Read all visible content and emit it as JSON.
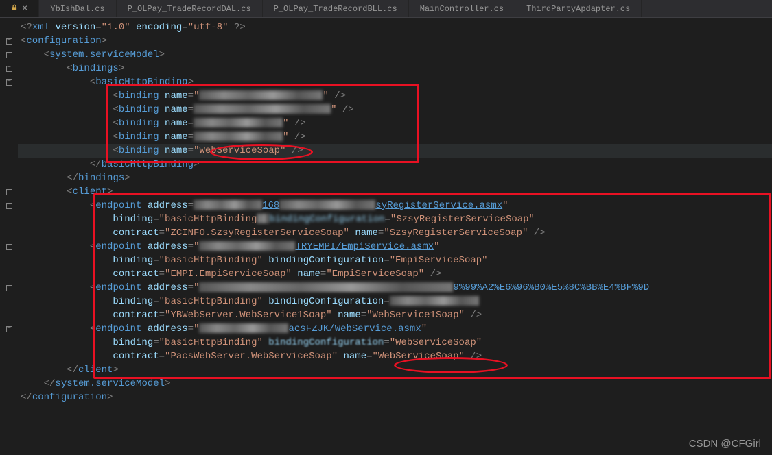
{
  "tabs": [
    {
      "label": "",
      "active": true,
      "hasLock": true,
      "hasClose": true
    },
    {
      "label": "YbIshDal.cs",
      "active": false
    },
    {
      "label": "P_OLPay_TradeRecordDAL.cs",
      "active": false
    },
    {
      "label": "P_OLPay_TradeRecordBLL.cs",
      "active": false
    },
    {
      "label": "MainController.cs",
      "active": false
    },
    {
      "label": "ThirdPartyApdapter.cs",
      "active": false
    }
  ],
  "xml_header": "<?xml version=\"1.0\" encoding=\"utf-8\" ?>",
  "tags": {
    "configuration_open": "configuration",
    "configuration_close": "configuration",
    "system_open": "system.serviceModel",
    "system_close": "system.serviceModel",
    "bindings_open": "bindings",
    "bindings_close": "bindings",
    "basicHttp_open": "basicHttpBinding",
    "basicHttp_close": "basicHttpBinding",
    "binding": "binding",
    "client_open": "client",
    "client_close": "client",
    "endpoint": "endpoint"
  },
  "attrs": {
    "name": "name",
    "address": "address",
    "binding": "binding",
    "bindingConfiguration": "bindingConfiguration",
    "contract": "contract"
  },
  "binding_names": {
    "webServiceSoap": "WebServiceSoap"
  },
  "endpoints": {
    "ep1": {
      "address_visible_suffix": "syRegisterService.asmx",
      "address_mid": "168",
      "binding": "basicHttpBinding",
      "bindingConfiguration": "SzsyRegisterServiceSoap",
      "contract": "ZCINFO.SzsyRegisterServiceSoap",
      "name": "SzsyRegisterServiceSoap"
    },
    "ep2": {
      "address_visible_suffix": "TRYEMPI/EmpiService.asmx",
      "binding": "basicHttpBinding",
      "bindingConfiguration": "EmpiServiceSoap",
      "contract": "EMPI.EmpiServiceSoap",
      "name": "EmpiServiceSoap"
    },
    "ep3": {
      "address_visible_suffix": "9%99%A2%E6%96%B0%E5%8C%BB%E4%BF%9D",
      "binding": "basicHttpBinding",
      "bindingConfiguration_visible": "WebService1Soap",
      "contract": "YBWebServer.WebService1Soap",
      "name": "WebService1Soap"
    },
    "ep4": {
      "address_visible_suffix": "acsFZJK/WebService.asmx",
      "binding": "basicHttpBinding",
      "bindingConfiguration": "WebServiceSoap",
      "contract": "PacsWebServer.WebServiceSoap",
      "name": "WebServiceSoap"
    }
  },
  "watermark": "CSDN @CFGirl"
}
